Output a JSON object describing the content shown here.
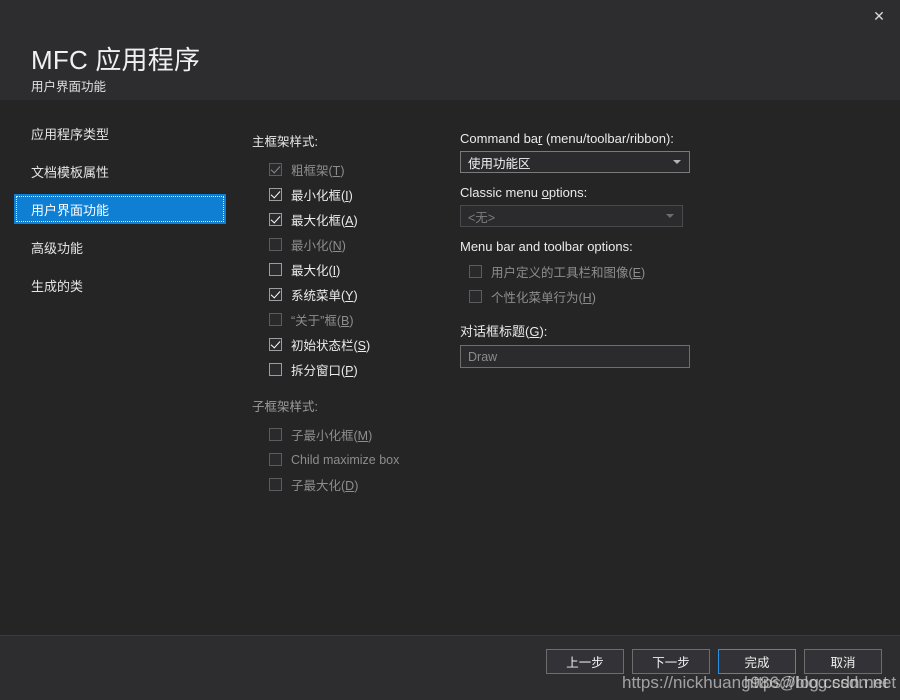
{
  "window": {
    "close_label": "✕",
    "title": "MFC 应用程序",
    "subtitle": "用户界面功能"
  },
  "colors": {
    "header_bg": "#2d2d30",
    "body_bg": "#252526",
    "footer_bg": "#2d2d30",
    "accent_selected": "#0f7fd4",
    "focus_border": "#2a8fe0"
  },
  "sidebar": {
    "items": [
      {
        "label": "应用程序类型",
        "selected": false
      },
      {
        "label": "文档模板属性",
        "selected": false
      },
      {
        "label": "用户界面功能",
        "selected": true
      },
      {
        "label": "高级功能",
        "selected": false
      },
      {
        "label": "生成的类",
        "selected": false
      }
    ]
  },
  "main_frame": {
    "group_label": "主框架样式:",
    "options": [
      {
        "label": "粗框架(T)",
        "checked": true,
        "enabled": false
      },
      {
        "label": "最小化框(I)",
        "checked": true,
        "enabled": true
      },
      {
        "label": "最大化框(A)",
        "checked": true,
        "enabled": true
      },
      {
        "label": "最小化(N)",
        "checked": false,
        "enabled": false
      },
      {
        "label": "最大化(I)",
        "checked": false,
        "enabled": true
      },
      {
        "label": "系统菜单(Y)",
        "checked": true,
        "enabled": true
      },
      {
        "label": "“关于”框(B)",
        "checked": false,
        "enabled": false
      },
      {
        "label": "初始状态栏(S)",
        "checked": true,
        "enabled": true
      },
      {
        "label": "拆分窗口(P)",
        "checked": false,
        "enabled": true
      }
    ]
  },
  "child_frame": {
    "group_label": "子框架样式:",
    "options": [
      {
        "label": "子最小化框(M)",
        "checked": false,
        "enabled": false
      },
      {
        "label": "Child maximize box",
        "checked": false,
        "enabled": false
      },
      {
        "label": "子最大化(D)",
        "checked": false,
        "enabled": false
      }
    ]
  },
  "command_bar": {
    "label": "Command bar (menu/toolbar/ribbon):",
    "value": "使用功能区"
  },
  "classic_menu": {
    "label": "Classic menu options:",
    "value": "<无>"
  },
  "menu_toolbar": {
    "group_label": "Menu bar and toolbar options:",
    "options": [
      {
        "label": "用户定义的工具栏和图像(E)",
        "checked": false,
        "enabled": false
      },
      {
        "label": "个性化菜单行为(H)",
        "checked": false,
        "enabled": false
      }
    ]
  },
  "dialog_title": {
    "label": "对话框标题(G):",
    "value": "Draw"
  },
  "footer": {
    "buttons": [
      {
        "label": "上一步",
        "focused": false
      },
      {
        "label": "下一步",
        "focused": false
      },
      {
        "label": "完成",
        "focused": true
      },
      {
        "label": "取消",
        "focused": false
      }
    ]
  },
  "watermarks": {
    "first": "https://nickhuang986@log.csdn.net",
    "second": "https://blog.csdn.net"
  }
}
